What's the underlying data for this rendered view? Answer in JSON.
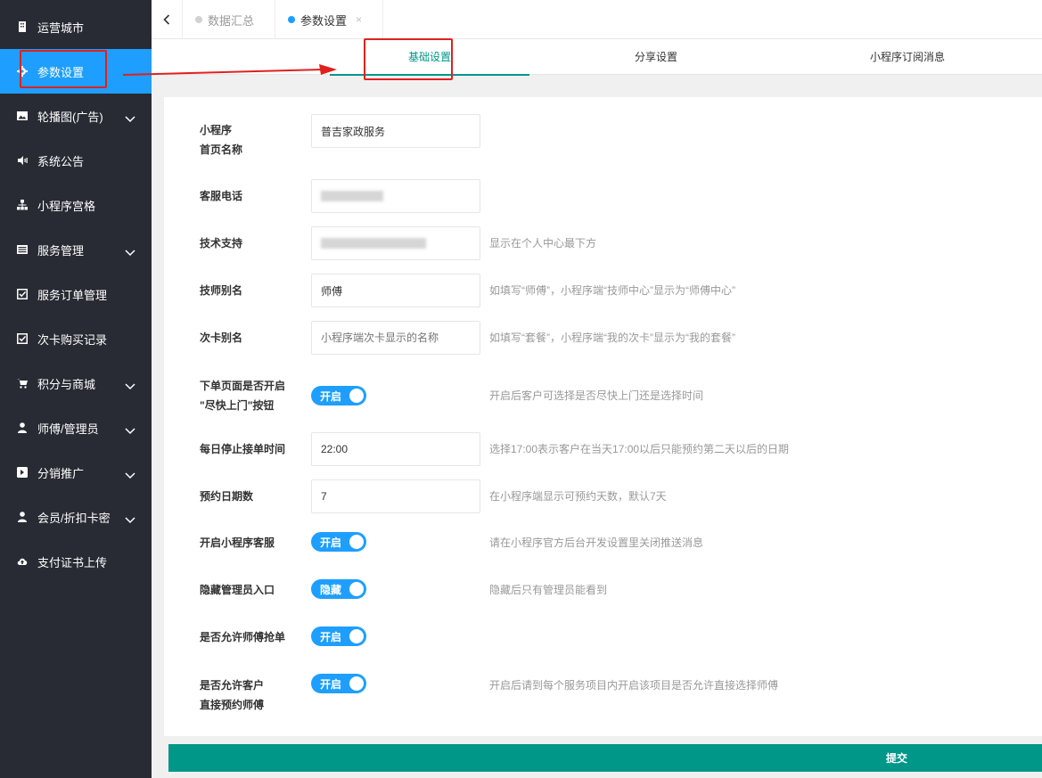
{
  "sidebar": {
    "items": [
      {
        "label": "运营城市",
        "icon": "building-icon",
        "has_children": false
      },
      {
        "label": "参数设置",
        "icon": "gear-icon",
        "has_children": false,
        "active": true
      },
      {
        "label": "轮播图(广告)",
        "icon": "image-icon",
        "has_children": true
      },
      {
        "label": "系统公告",
        "icon": "volume-icon",
        "has_children": false
      },
      {
        "label": "小程序宫格",
        "icon": "sitemap-icon",
        "has_children": false
      },
      {
        "label": "服务管理",
        "icon": "list-icon",
        "has_children": true
      },
      {
        "label": "服务订单管理",
        "icon": "checkbox-icon",
        "has_children": false
      },
      {
        "label": "次卡购买记录",
        "icon": "checkbox-icon",
        "has_children": false
      },
      {
        "label": "积分与商城",
        "icon": "cart-icon",
        "has_children": true
      },
      {
        "label": "师傅/管理员",
        "icon": "user-tie-icon",
        "has_children": true
      },
      {
        "label": "分销推广",
        "icon": "share-square-icon",
        "has_children": true
      },
      {
        "label": "会员/折扣卡密",
        "icon": "user-icon",
        "has_children": true
      },
      {
        "label": "支付证书上传",
        "icon": "cloud-upload-icon",
        "has_children": false
      }
    ]
  },
  "tabs": {
    "summary": "数据汇总",
    "params": "参数设置",
    "close_glyph": "×"
  },
  "subtabs": {
    "basic": "基础设置",
    "share": "分享设置",
    "subscribe": "小程序订阅消息"
  },
  "form": {
    "app_name": {
      "label_line1": "小程序",
      "label_line2": "首页名称",
      "value": "普吉家政服务"
    },
    "service_phone": {
      "label": "客服电话"
    },
    "tech_support": {
      "label": "技术支持",
      "hint": "显示在个人中心最下方"
    },
    "master_alias": {
      "label": "技师别名",
      "value": "师傅",
      "hint": "如填写“师傅”，小程序端“技师中心”显示为“师傅中心”"
    },
    "card_alias": {
      "label": "次卡别名",
      "placeholder": "小程序端次卡显示的名称",
      "hint": "如填写“套餐”，小程序端“我的次卡”显示为“我的套餐”"
    },
    "quick_door": {
      "label_line1": "下单页面是否开启",
      "label_line2": "\"尽快上门\"按钮",
      "switch": "开启",
      "hint": "开启后客户可选择是否尽快上门还是选择时间"
    },
    "stop_time": {
      "label": "每日停止接单时间",
      "value": "22:00",
      "hint": "选择17:00表示客户在当天17:00以后只能预约第二天以后的日期"
    },
    "booking_days": {
      "label": "预约日期数",
      "value": "7",
      "hint": "在小程序端显示可预约天数，默认7天"
    },
    "customer_service": {
      "label": "开启小程序客服",
      "switch": "开启",
      "hint": "请在小程序官方后台开发设置里关闭推送消息"
    },
    "hide_admin": {
      "label": "隐藏管理员入口",
      "switch": "隐藏",
      "hint": "隐藏后只有管理员能看到"
    },
    "grab_order": {
      "label": "是否允许师傅抢单",
      "switch": "开启"
    },
    "direct_book": {
      "label_line1": "是否允许客户",
      "label_line2": "直接预约师傅",
      "switch": "开启",
      "hint": "开启后请到每个服务项目内开启该项目是否允许直接选择师傅"
    }
  },
  "submit_label": "提交",
  "colors": {
    "sidebar_bg": "#282b33",
    "accent": "#1e9fff",
    "primary": "#009688",
    "annotation": "#e02020"
  }
}
